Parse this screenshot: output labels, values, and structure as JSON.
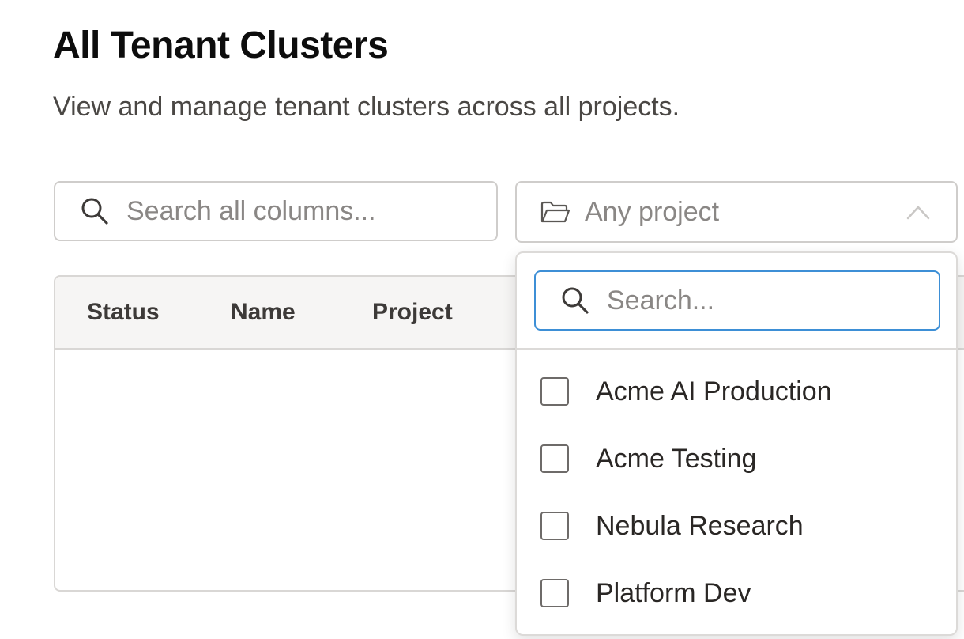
{
  "header": {
    "title": "All Tenant Clusters",
    "subtitle": "View and manage tenant clusters across all projects."
  },
  "filters": {
    "search_placeholder": "Search all columns...",
    "search_icon": "search-icon",
    "project_select_label": "Any project",
    "project_icon": "folder-icon",
    "chevron_icon": "chevron-up-icon"
  },
  "table": {
    "columns": [
      "Status",
      "Name",
      "Project"
    ]
  },
  "project_dropdown": {
    "search_placeholder": "Search...",
    "options": [
      {
        "label": "Acme AI Production",
        "checked": false
      },
      {
        "label": "Acme Testing",
        "checked": false
      },
      {
        "label": "Nebula Research",
        "checked": false
      },
      {
        "label": "Platform Dev",
        "checked": false
      }
    ]
  },
  "colors": {
    "accent_focus": "#3d8fd6",
    "border": "#cfcdcb",
    "header_bg": "#f6f5f4"
  }
}
